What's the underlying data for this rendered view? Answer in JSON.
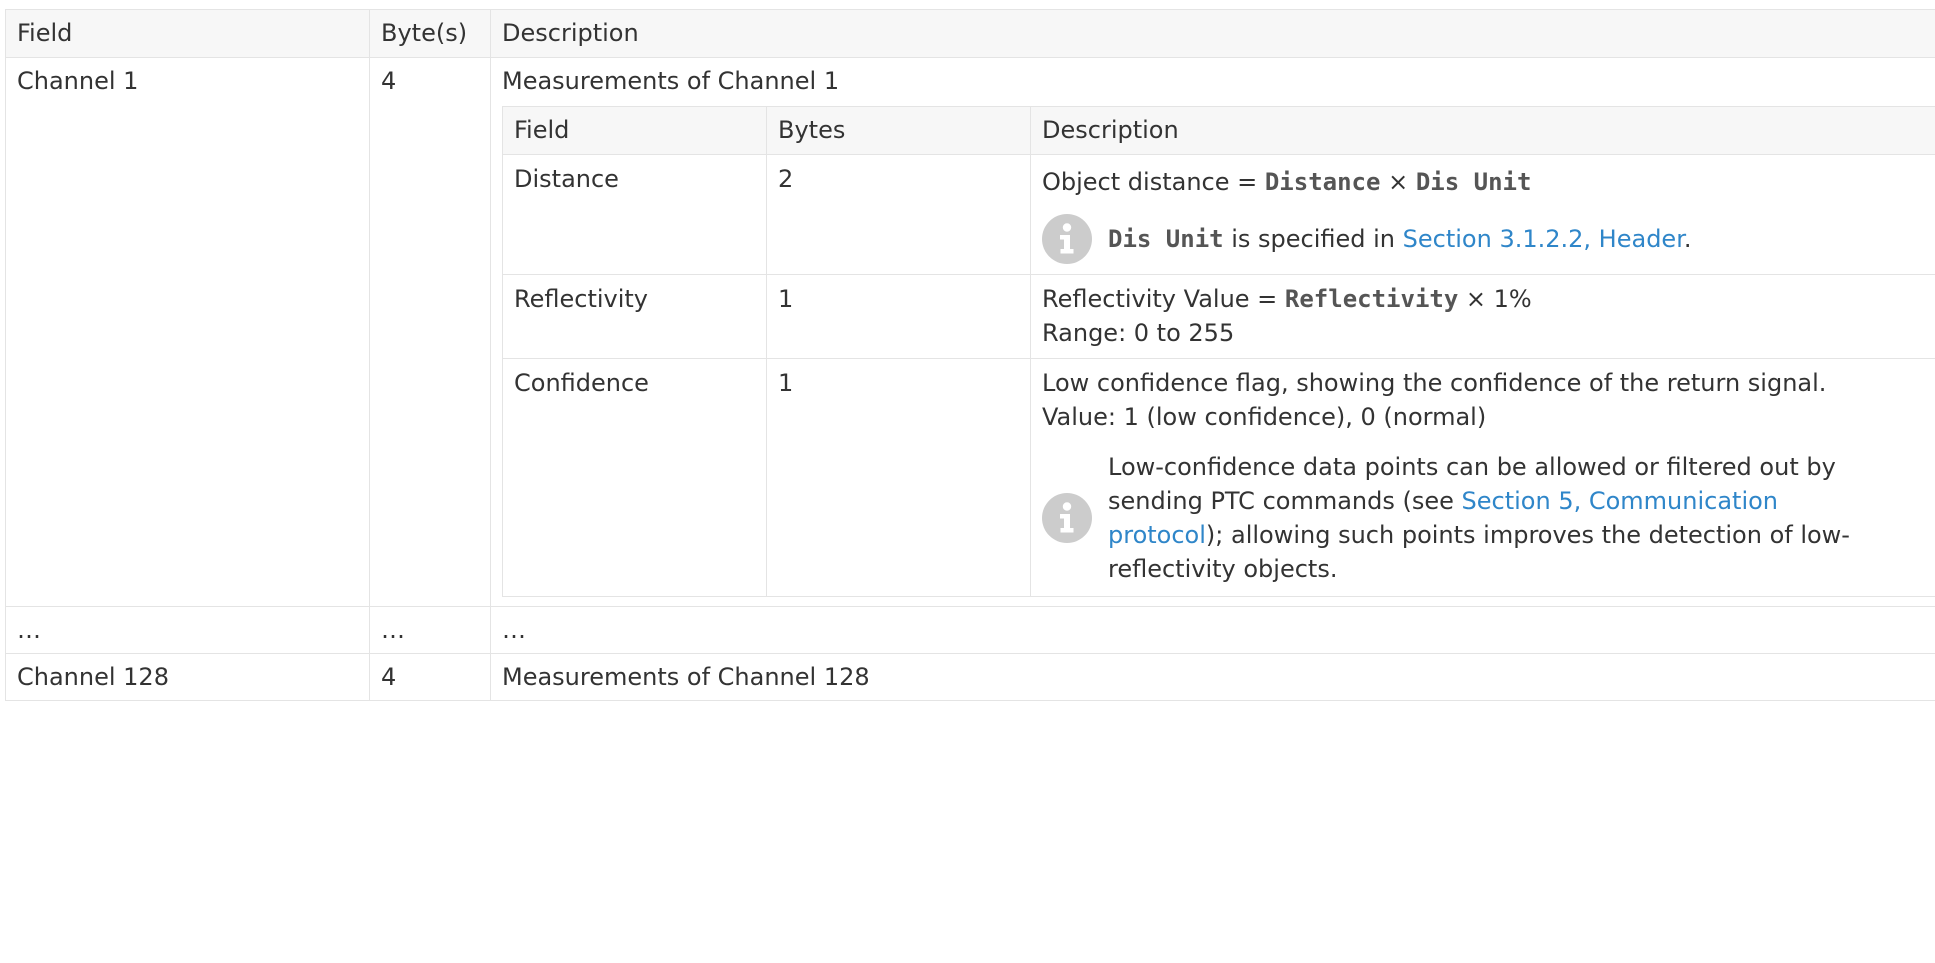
{
  "outer_table": {
    "headers": {
      "field": "Field",
      "bytes": "Byte(s)",
      "description": "Description"
    },
    "rows": [
      {
        "field": "Channel 1",
        "bytes": "4",
        "description": "Measurements of Channel 1"
      },
      {
        "field": "…",
        "bytes": "…",
        "description": "…"
      },
      {
        "field": "Channel 128",
        "bytes": "4",
        "description": "Measurements of Channel 128"
      }
    ]
  },
  "inner_table": {
    "headers": {
      "field": "Field",
      "bytes": "Bytes",
      "description": "Description"
    },
    "distance": {
      "field": "Distance",
      "bytes": "2",
      "desc_prefix": "Object distance = ",
      "desc_code1": "Distance",
      "desc_times": " × ",
      "desc_code2": "Dis Unit",
      "note_code": "Dis Unit",
      "note_text": " is specified in ",
      "note_link": "Section 3.1.2.2, Header",
      "note_end": "."
    },
    "reflectivity": {
      "field": "Reflectivity",
      "bytes": "1",
      "desc_prefix": "Reflectivity Value = ",
      "desc_code": "Reflectivity",
      "desc_suffix": " × 1%",
      "range": "Range: 0 to 255"
    },
    "confidence": {
      "field": "Confidence",
      "bytes": "1",
      "desc_line1": "Low confidence flag, showing the confidence of the return signal.",
      "desc_value": "Value: 1 (low confidence), 0 (normal)",
      "note_before": "Low-confidence data points can be allowed or filtered out by sending PTC commands (see ",
      "note_link": "Section 5, Communication protocol",
      "note_after": "); allowing such points improves the detection of low-reflectivity objects."
    }
  },
  "icons": {
    "note": "info-icon",
    "icon_bg": "#cccccc",
    "icon_fg": "#ffffff",
    "link_color": "#2f86c9",
    "header_bg": "#f7f7f7",
    "border": "#e4e4e4"
  }
}
